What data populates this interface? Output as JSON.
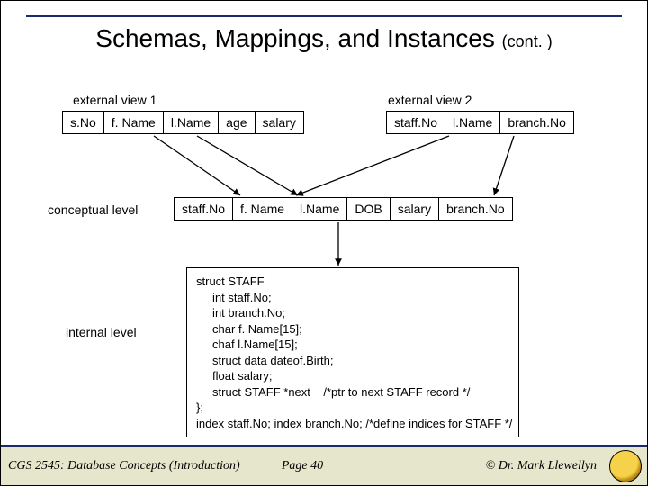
{
  "title": {
    "main": "Schemas, Mappings, and Instances",
    "cont": "(cont. )"
  },
  "labels": {
    "ext1": "external view 1",
    "ext2": "external view 2",
    "conceptual": "conceptual level",
    "internal": "internal level"
  },
  "ext1_cols": {
    "c0": "s.No",
    "c1": "f. Name",
    "c2": "l.Name",
    "c3": "age",
    "c4": "salary"
  },
  "ext2_cols": {
    "c0": "staff.No",
    "c1": "l.Name",
    "c2": "branch.No"
  },
  "conc_cols": {
    "c0": "staff.No",
    "c1": "f. Name",
    "c2": "l.Name",
    "c3": "DOB",
    "c4": "salary",
    "c5": "branch.No"
  },
  "code": "struct STAFF\n     int staff.No;\n     int branch.No;\n     char f. Name[15];\n     chaf l.Name[15];\n     struct data dateof.Birth;\n     float salary;\n     struct STAFF *next    /*ptr to next STAFF record */\n};\nindex staff.No; index branch.No; /*define indices for STAFF */",
  "footer": {
    "left": "CGS 2545: Database Concepts  (Introduction)",
    "center": "Page 40",
    "right": "© Dr. Mark Llewellyn"
  }
}
